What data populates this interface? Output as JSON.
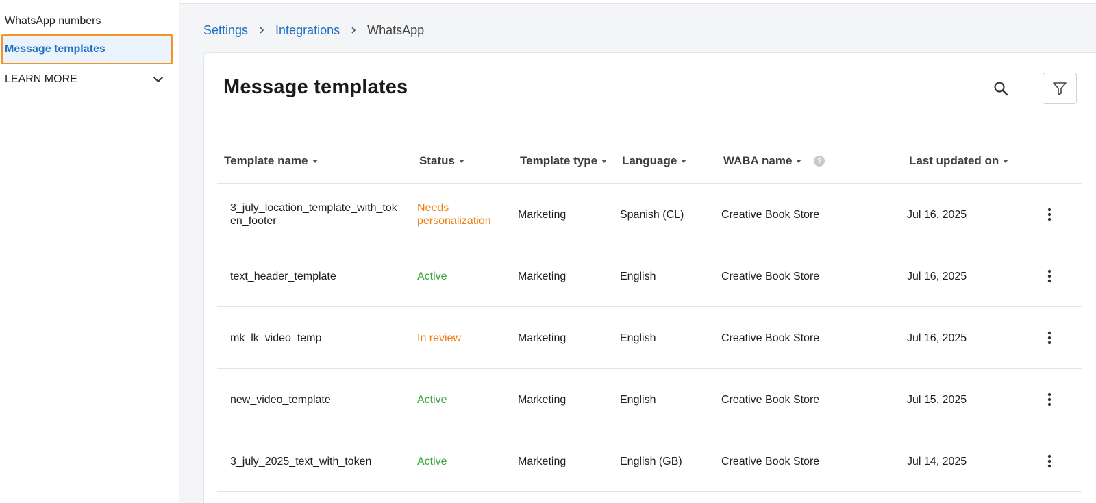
{
  "sidebar": {
    "items": [
      {
        "label": "WhatsApp numbers"
      },
      {
        "label": "Message templates"
      },
      {
        "label": "LEARN MORE"
      }
    ]
  },
  "breadcrumb": {
    "items": [
      "Settings",
      "Integrations",
      "WhatsApp"
    ]
  },
  "page": {
    "title": "Message templates",
    "search_icon": "search-icon",
    "filter_icon": "filter-icon"
  },
  "table": {
    "columns": [
      "Template name",
      "Status",
      "Template type",
      "Language",
      "WABA name",
      "Last updated on"
    ],
    "rows": [
      {
        "name": "3_july_location_template_with_token_footer",
        "status": "Needs personalization",
        "type": "Marketing",
        "language": "Spanish (CL)",
        "waba": "Creative Book Store",
        "updated": "Jul 16, 2025"
      },
      {
        "name": "text_header_template",
        "status": "Active",
        "type": "Marketing",
        "language": "English",
        "waba": "Creative Book Store",
        "updated": "Jul 16, 2025"
      },
      {
        "name": "mk_lk_video_temp",
        "status": "In review",
        "type": "Marketing",
        "language": "English",
        "waba": "Creative Book Store",
        "updated": "Jul 16, 2025"
      },
      {
        "name": "new_video_template",
        "status": "Active",
        "type": "Marketing",
        "language": "English",
        "waba": "Creative Book Store",
        "updated": "Jul 15, 2025"
      },
      {
        "name": "3_july_2025_text_with_token",
        "status": "Active",
        "type": "Marketing",
        "language": "English (GB)",
        "waba": "Creative Book Store",
        "updated": "Jul 14, 2025"
      }
    ]
  },
  "colors": {
    "accent": "#1f6fc5",
    "highlight_border": "#f29423",
    "status_orange": "#f07d10",
    "status_green": "#3aa53e"
  }
}
